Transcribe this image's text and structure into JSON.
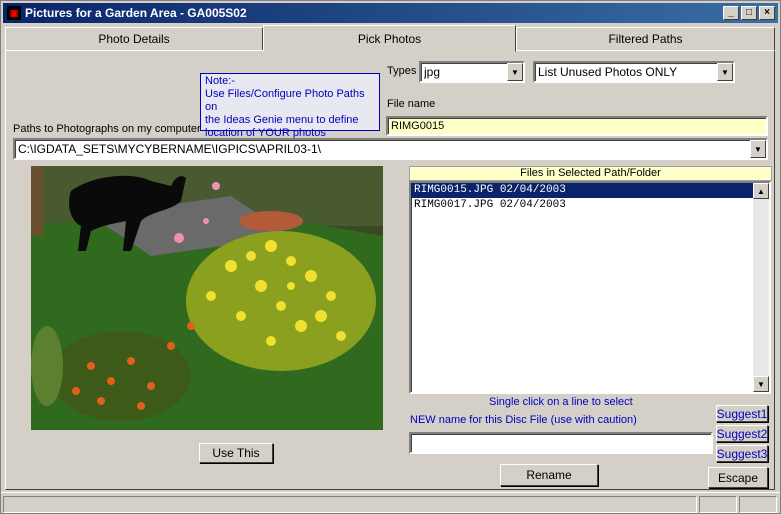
{
  "window": {
    "title": "Pictures for a Garden Area - GA005S02",
    "minimize": "_",
    "maximize": "□",
    "close": "×"
  },
  "tabs": [
    {
      "label": "Photo Details",
      "active": false
    },
    {
      "label": "Pick Photos",
      "active": true
    },
    {
      "label": "Filtered Paths",
      "active": false
    }
  ],
  "note": {
    "line1": "Note:-",
    "line2": "Use Files/Configure Photo Paths on",
    "line3": "the Ideas Genie menu to define",
    "line4": "location of YOUR photos"
  },
  "types": {
    "label": "Types",
    "value": "jpg"
  },
  "filter": {
    "value": "List Unused Photos ONLY"
  },
  "filename": {
    "label": "File name",
    "value": "RIMG0015"
  },
  "paths": {
    "label": "Paths to Photographs on my computer",
    "value": "C:\\IGDATA_SETS\\MYCYBERNAME\\IGPICS\\APRIL03-1\\"
  },
  "files": {
    "header": "Files in Selected Path/Folder",
    "items": [
      "RIMG0015.JPG 02/04/2003",
      "RIMG0017.JPG 02/04/2003"
    ],
    "selected_index": 0,
    "hint": "Single click on a line to select"
  },
  "rename": {
    "label": "NEW name for this Disc File (use with caution)",
    "value": "",
    "button": "Rename"
  },
  "buttons": {
    "use_this": "Use This",
    "suggest1": "Suggest1",
    "suggest2": "Suggest2",
    "suggest3": "Suggest3",
    "escape": "Escape"
  },
  "colors": {
    "title_bar": "#0a246a",
    "highlight_text": "#0000c0",
    "field_yellow": "#ffffc8",
    "face": "#d4d0c8"
  }
}
